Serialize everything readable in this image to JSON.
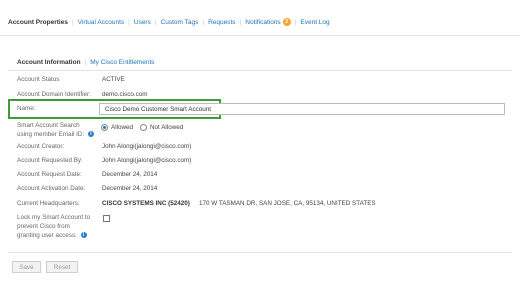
{
  "topnav": {
    "tabs": [
      {
        "label": "Account Properties"
      },
      {
        "label": "Virtual Accounts"
      },
      {
        "label": "Users"
      },
      {
        "label": "Custom Tags"
      },
      {
        "label": "Requests"
      },
      {
        "label": "Notifications"
      },
      {
        "label": "Event Log"
      }
    ],
    "notifications_badge": "2"
  },
  "subnav": {
    "account_information": "Account Information",
    "my_cisco_entitlements": "My Cisco Entitlements"
  },
  "fields": {
    "account_status": {
      "label": "Account Status",
      "value": "ACTIVE"
    },
    "account_domain": {
      "label": "Account Domain Identifier:",
      "value": "demo.cisco.com"
    },
    "name": {
      "label": "Name:",
      "value": "Cisco Demo Customer Smart Account"
    },
    "search": {
      "label_line1": "Smart Account Search",
      "label_line2": "using member Email ID:",
      "option_allowed": "Allowed",
      "option_not_allowed": "Not Allowed",
      "selected": "Allowed"
    },
    "account_creator": {
      "label": "Account Creator:",
      "value": "John Alongi(jalongi@cisco.com)"
    },
    "account_requested_by": {
      "label": "Account Requested By:",
      "value": "John Alongi(jalongi@cisco.com)"
    },
    "account_request_date": {
      "label": "Account Request Date:",
      "value": "December 24, 2014"
    },
    "account_activation_date": {
      "label": "Account Activation Date:",
      "value": "December 24, 2014"
    },
    "current_headquarters": {
      "label": "Current Headquarters:",
      "company": "CISCO SYSTEMS INC (52420)",
      "address": "170 W TASMAN DR, SAN JOSE, CA, 95134, UNITED STATES"
    },
    "lock_account": {
      "label_line1": "Lock my Smart Account to",
      "label_line2": "prevent Cisco from",
      "label_line3": "granting user access:",
      "checked": false
    }
  },
  "buttons": {
    "save": "Save",
    "reset": "Reset"
  },
  "colors": {
    "link": "#1e73be",
    "highlight_border": "#3f9b3a",
    "badge": "#f0a830",
    "info_icon": "#2b7fd4"
  },
  "icons": {
    "info": "info-icon"
  }
}
